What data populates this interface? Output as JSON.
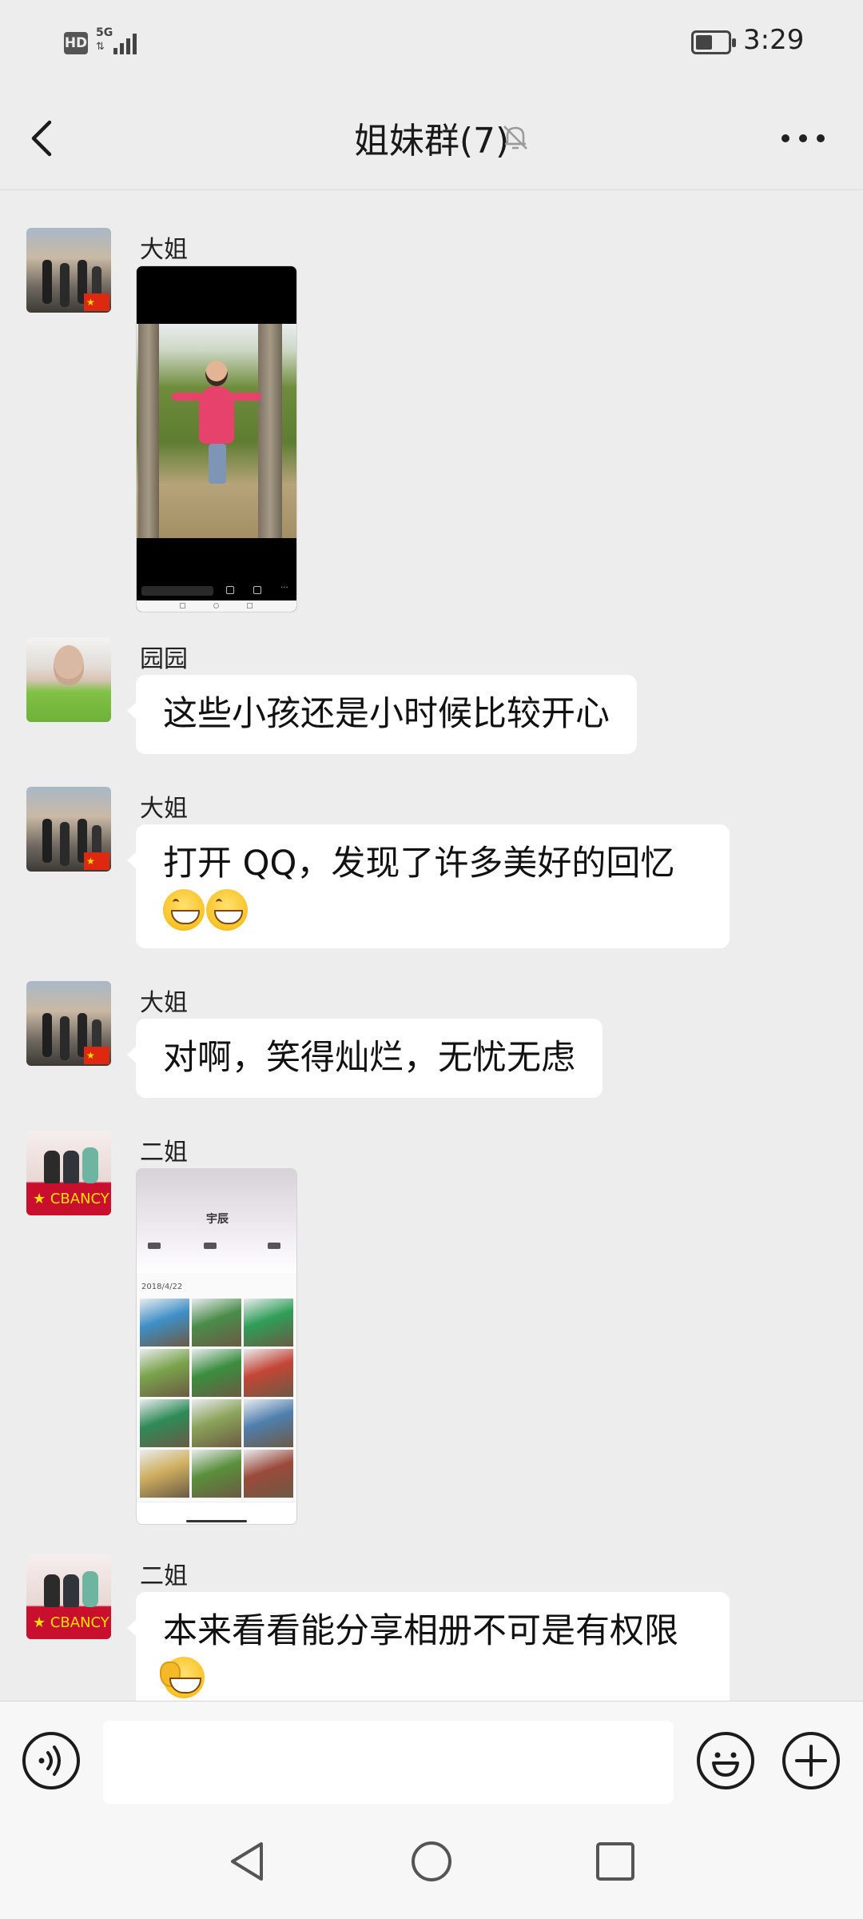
{
  "status_bar": {
    "hd_label": "HD",
    "network_label": "5G",
    "time": "3:29"
  },
  "header": {
    "title": "姐妹群(7)",
    "back_icon": "chevron-left-icon",
    "mute_icon": "bell-off-icon",
    "more_icon": "more-horizontal-icon"
  },
  "messages": [
    {
      "sender": "大姐",
      "avatar": "sister-photo",
      "type": "image",
      "image": {
        "description_key": "child-photo-screenshot"
      }
    },
    {
      "sender": "园园",
      "avatar": "yuanyuan-photo",
      "type": "text",
      "text": "这些小孩还是小时候比较开心"
    },
    {
      "sender": "大姐",
      "avatar": "sister-photo",
      "type": "text",
      "text": "打开 QQ，发现了许多美好的回忆",
      "emojis": [
        "grin-emoji",
        "grin-emoji"
      ]
    },
    {
      "sender": "大姐",
      "avatar": "sister-photo",
      "type": "text",
      "text": "对啊，笑得灿烂，无忧无虑"
    },
    {
      "sender": "二姐",
      "avatar": "ersister-photo",
      "type": "image",
      "image": {
        "album_title": "宇辰",
        "date": "2018/4/22"
      }
    },
    {
      "sender": "二姐",
      "avatar": "ersister-photo",
      "type": "text",
      "text": "本来看看能分享相册不可是有权限",
      "emojis": [
        "facepalm-emoji"
      ]
    }
  ],
  "input_bar": {
    "voice_icon": "voice-icon",
    "input_value": "",
    "emoji_icon": "smiley-icon",
    "plus_icon": "plus-circle-icon"
  },
  "nav_bar": {
    "back_icon": "triangle-back-icon",
    "home_icon": "circle-home-icon",
    "recent_icon": "square-recent-icon"
  },
  "colors": {
    "background": "#ededed",
    "bubble": "#ffffff",
    "text": "#191919"
  }
}
